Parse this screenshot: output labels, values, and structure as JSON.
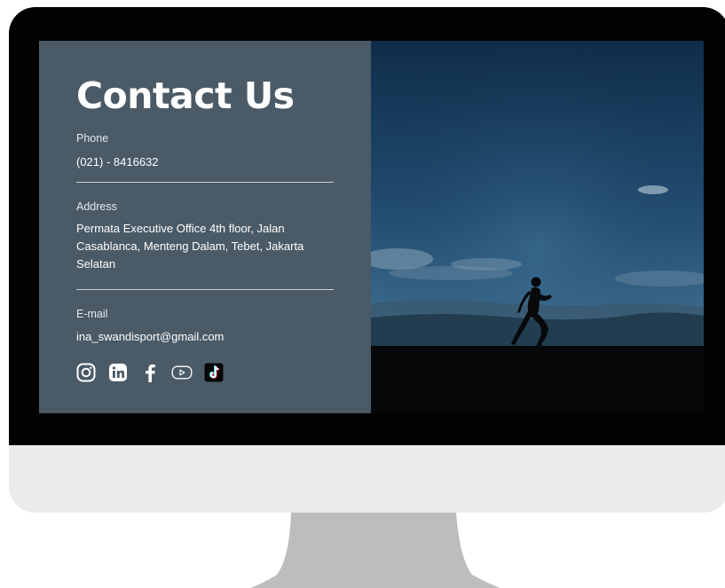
{
  "contact": {
    "title": "Contact Us",
    "phone": {
      "label": "Phone",
      "value": "(021) - 8416632"
    },
    "address": {
      "label": "Address",
      "lines": [
        "Permata Executive Office 4th floor, Jalan",
        "Casablanca, Menteng Dalam, Tebet, Jakarta",
        "Selatan"
      ]
    },
    "email": {
      "label": "E-mail",
      "value": "ina_swandisport@gmail.com"
    },
    "social": [
      {
        "icon": "instagram-icon"
      },
      {
        "icon": "linkedin-icon"
      },
      {
        "icon": "facebook-icon"
      },
      {
        "icon": "youtube-icon"
      },
      {
        "icon": "tiktok-icon"
      }
    ]
  },
  "colors": {
    "panel": "#4a5a66",
    "bezel": "#020202",
    "monitor_body": "#ebebeb",
    "stand": "#bdbdbd",
    "text": "#ffffff",
    "sky_top": "#0f2d49",
    "sky_mid": "#2f5f86",
    "horizon": "#6d8ea5",
    "ground": "#060708"
  },
  "photo": {
    "subject": "runner-silhouette"
  }
}
